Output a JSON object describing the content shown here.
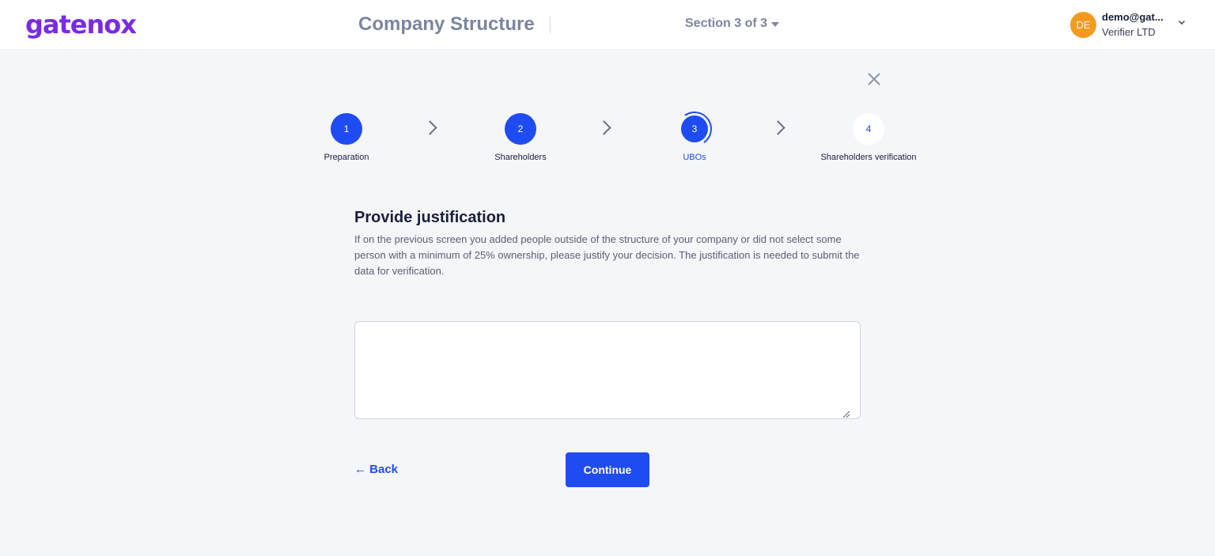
{
  "header": {
    "logo_text": "gatenox",
    "page_title": "Company Structure",
    "section_label": "Section 3 of 3",
    "user": {
      "initials": "DE",
      "email": "demo@gat...",
      "organization": "Verifier LTD"
    }
  },
  "stepper": {
    "steps": [
      {
        "number": "1",
        "label": "Preparation",
        "state": "completed"
      },
      {
        "number": "2",
        "label": "Shareholders",
        "state": "completed"
      },
      {
        "number": "3",
        "label": "UBOs",
        "state": "current"
      },
      {
        "number": "4",
        "label": "Shareholders verification",
        "state": "pending"
      }
    ]
  },
  "form": {
    "heading": "Provide justification",
    "description": "If on the previous screen you added people outside of the structure of your company or did not select some person with a minimum of 25% ownership, please justify your decision. The justification is needed to submit the data for verification.",
    "justification_value": "",
    "back_label": "← Back",
    "continue_label": "Continue"
  },
  "colors": {
    "brand": "#7a2be2",
    "accent": "#1f4cf2",
    "avatar": "#f49a1f",
    "background": "#f5f6fa"
  },
  "icons": [
    "caret-down-icon",
    "chevron-down-icon",
    "close-icon",
    "chevron-right-icon"
  ]
}
